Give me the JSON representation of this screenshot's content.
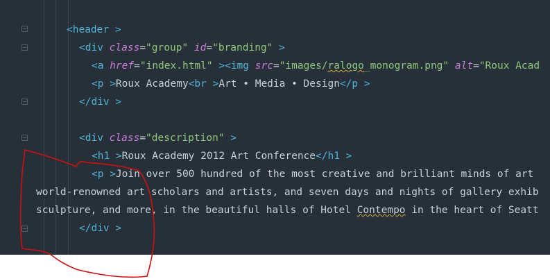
{
  "code": {
    "header_open": "<header >",
    "div_group": {
      "open": "<div",
      "attr1": "class",
      "eq1": "=",
      "val1": "\"group\"",
      "attr2": "id",
      "eq2": "=",
      "val2": "\"branding\"",
      "close": " >"
    },
    "a_line": {
      "a_open": "<a",
      "href": "href",
      "eq": "=",
      "href_val": "\"index.html\"",
      "a_close": " >",
      "img_open": "<img",
      "src": "src",
      "eq2": "=",
      "src_pre": "\"images/",
      "src_sq": "ralogo",
      "src_post": "_monogram.png\"",
      "alt": "alt",
      "eq3": "=",
      "alt_val": "\"Roux Acad"
    },
    "p_line": {
      "open": "<p >",
      "text1": "Roux Academy",
      "br": "<br >",
      "text2": "Art • Media • Design",
      "close": "</p >"
    },
    "div_close_1": "</div >",
    "div_desc": {
      "open": "<div",
      "attr": "class",
      "eq": "=",
      "val": "\"description\"",
      "close": " >"
    },
    "h1_line": {
      "open": "<h1 >",
      "text": "Roux Academy 2012 Art Conference",
      "close": "</h1 >"
    },
    "p2_line": {
      "open": "<p >",
      "text": "Join over 500 hundred of the most creative and brilliant minds of art"
    },
    "wrap1": "world-renowned art scholars and artists, and seven days and nights of gallery exhib",
    "wrap2": {
      "pre": "sculpture, and more, in the beautiful halls of Hotel ",
      "sq": "Contempo",
      "post": " in the heart of Seatt"
    },
    "div_close_2": "</div >"
  },
  "colors": {
    "background": "#273038",
    "tag": "#4fb4d8",
    "bracket": "#cf5858",
    "attribute": "#c978d8",
    "string": "#8fc77a",
    "text": "#c8d0d8",
    "annotation": "#d01010"
  },
  "icons": [
    "fold-marker-icon"
  ]
}
